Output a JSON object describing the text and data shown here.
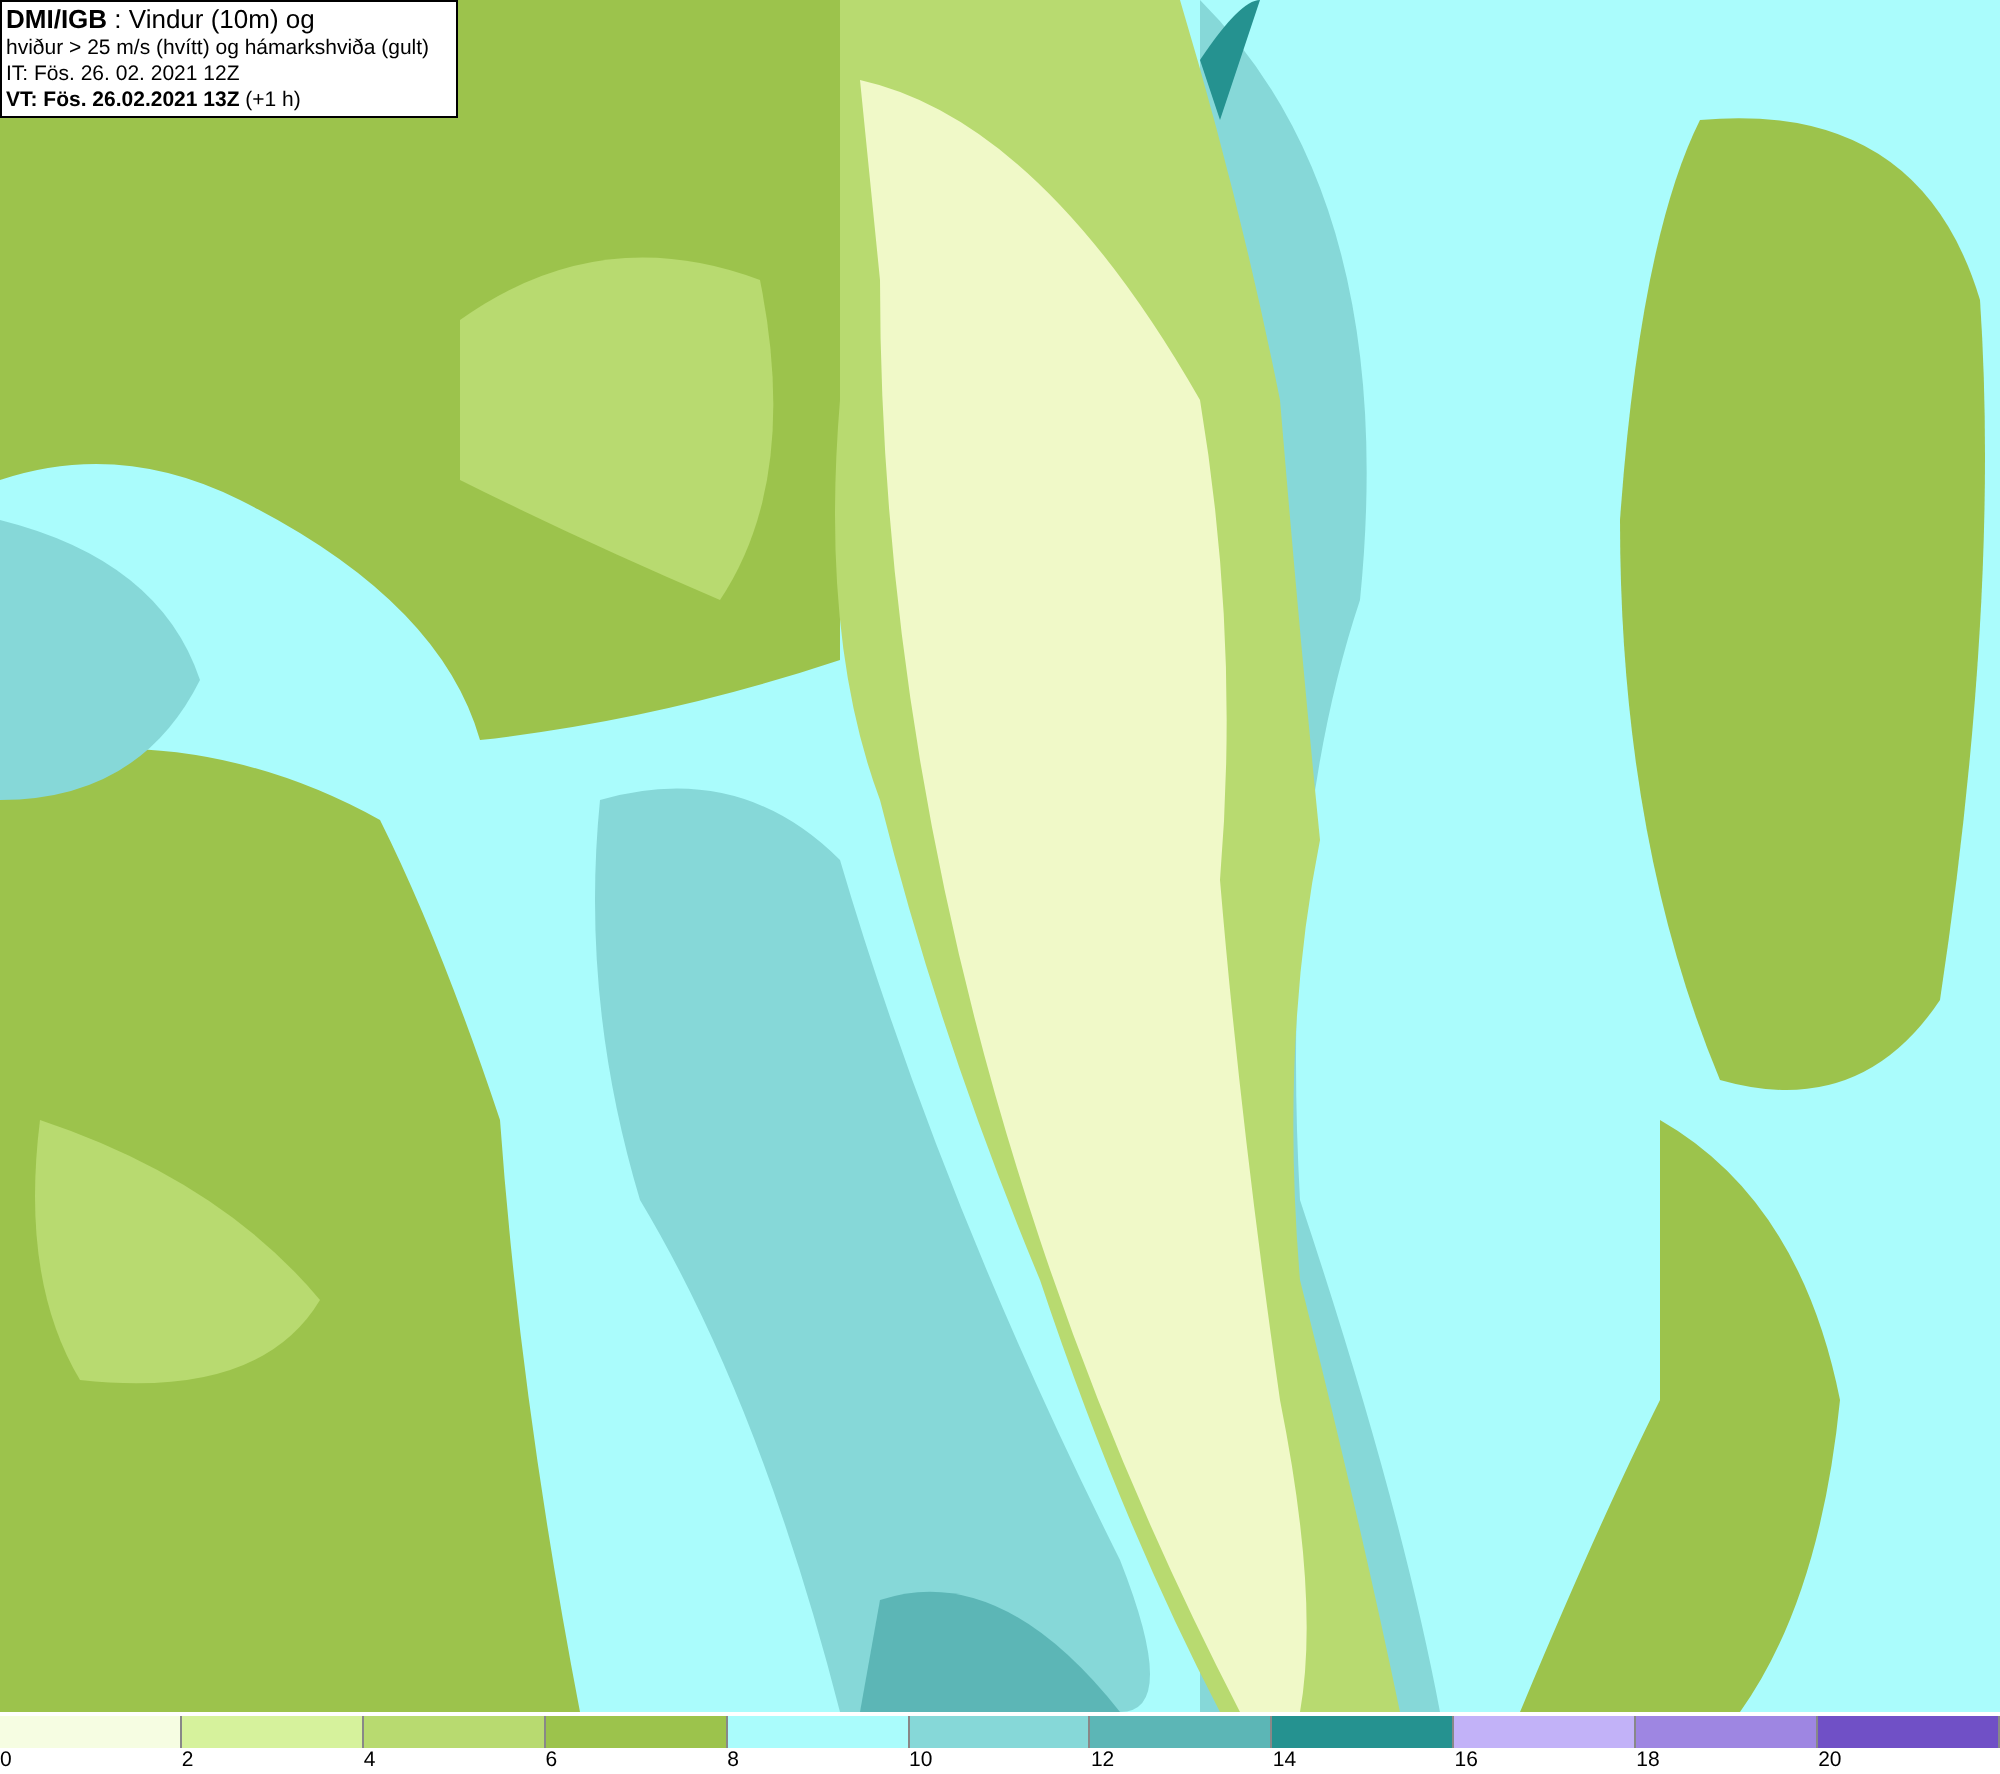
{
  "header": {
    "lines": [
      "**DMI/IGB** : Vindur (10m) og",
      "hviður > 25 m/s (hvítt) og hámarkshviða (gult)",
      "IT: Fös. 26. 02. 2021 12Z",
      "**VT: Fös. 26.02.2021 13Z** (+1 h)"
    ]
  },
  "legend": {
    "swatches": [
      {
        "color": "#f6fde2"
      },
      {
        "color": "#d6f29c"
      },
      {
        "color": "#b8da70"
      },
      {
        "color": "#9cc34c"
      },
      {
        "color": "#aafcfc"
      },
      {
        "color": "#86d8d8"
      },
      {
        "color": "#5cb6b6"
      },
      {
        "color": "#259290"
      },
      {
        "color": "#c2b2f8"
      },
      {
        "color": "#9e86e2"
      },
      {
        "color": "#7050c6"
      }
    ],
    "labels": [
      "0",
      "2",
      "4",
      "6",
      "8",
      "10",
      "12",
      "14",
      "16",
      "18",
      "20"
    ]
  }
}
